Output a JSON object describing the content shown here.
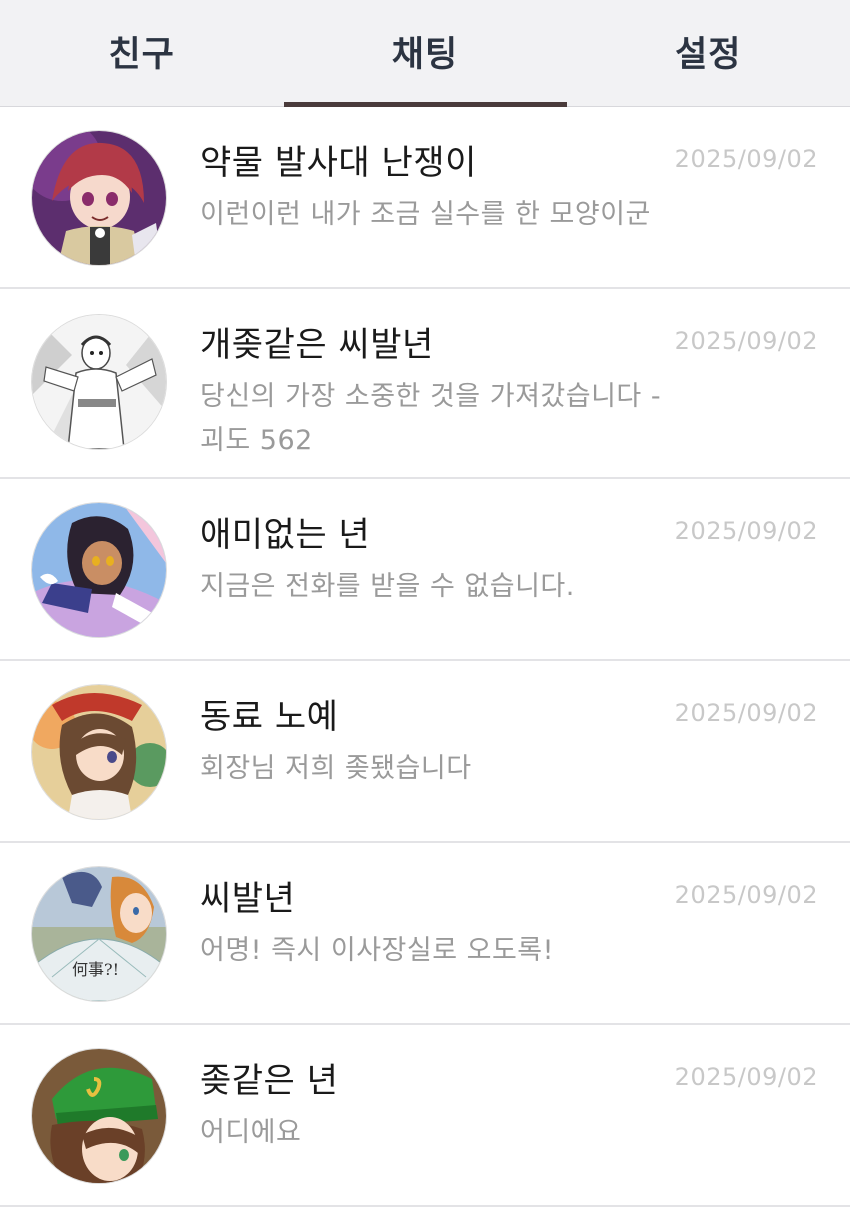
{
  "tabs": [
    {
      "label": "친구"
    },
    {
      "label": "채팅"
    },
    {
      "label": "설정"
    }
  ],
  "active_tab": "채팅",
  "colors": {
    "tab_bar_bg": "#f2f2f4",
    "tab_text": "#2c3442",
    "tab_indicator": "#4a3b3b",
    "name_text": "#1a1a1a",
    "preview_text": "#9a9a9a",
    "date_text": "#c8c8c8"
  },
  "chats": [
    {
      "name": "약물 발사대 난쟁이",
      "preview": "이런이런 내가 조금 실수를 한 모양이군",
      "date": "2025/09/02",
      "avatar": "anime-girl-red-hair-avatar"
    },
    {
      "name": "개좆같은 씨발년",
      "preview": "당신의 가장 소중한 것을 가져갔습니다 -괴도 562",
      "date": "2025/09/02",
      "avatar": "anime-girl-monochrome-avatar"
    },
    {
      "name": "애미없는 년",
      "preview": "지금은 전화를 받을 수 없습니다.",
      "date": "2025/09/02",
      "avatar": "anime-girl-dark-hair-avatar"
    },
    {
      "name": "동료 노예",
      "preview": "회장님 저희 좆됐습니다",
      "date": "2025/09/02",
      "avatar": "anime-girl-brown-hair-avatar"
    },
    {
      "name": "씨발년",
      "preview": "어명! 즉시 이사장실로 오도록!",
      "date": "2025/09/02",
      "avatar": "anime-girl-fan-avatar"
    },
    {
      "name": "좆같은 년",
      "preview": "어디에요",
      "date": "2025/09/02",
      "avatar": "anime-girl-green-hat-avatar"
    }
  ]
}
